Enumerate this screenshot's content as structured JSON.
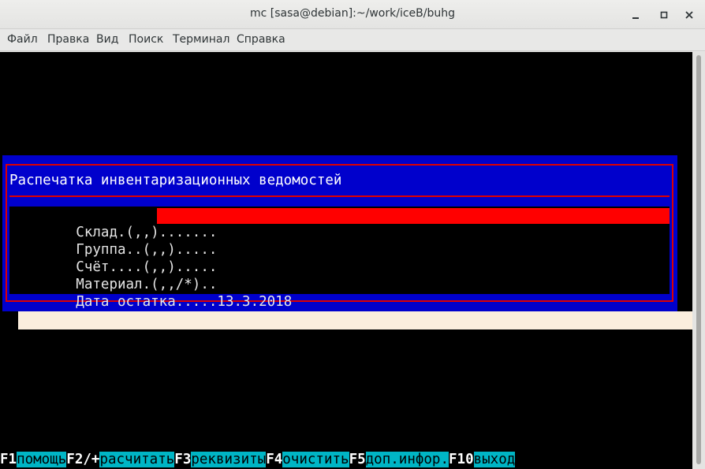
{
  "window": {
    "title": "mc [sasa@debian]:~/work/iceB/buhg",
    "buttons": {
      "minimize": "_",
      "maximize": "□",
      "close": "✕"
    }
  },
  "menubar": {
    "items": [
      "Файл",
      "Правка",
      "Вид",
      "Поиск",
      "Терминал",
      "Справка"
    ]
  },
  "dialog": {
    "title": "Распечатка инвентаризационных ведомостей",
    "fields": [
      {
        "label": "Склад.(,,).......",
        "value": ""
      },
      {
        "label": "Группа..(,,).....",
        "value": ""
      },
      {
        "label": "Счёт....(,,).....",
        "value": ""
      },
      {
        "label": "Материал.(,,/*)..",
        "value": ""
      },
      {
        "label": "Дата остатка.....",
        "value": "13.3.2018"
      }
    ]
  },
  "fkeys": [
    {
      "key": "F1",
      "label": "помощь"
    },
    {
      "key": "F2/+",
      "label": "расчитать"
    },
    {
      "key": "F3",
      "label": "реквизиты"
    },
    {
      "key": "F4",
      "label": "очистить"
    },
    {
      "key": "F5",
      "label": "доп.инфор."
    },
    {
      "key": "F10",
      "label": "выход"
    }
  ],
  "colors": {
    "dialog_bg": "#0000cc",
    "frame": "#dd0000",
    "active_input": "#ff0000",
    "fkey_label_bg": "#00b5c5"
  }
}
